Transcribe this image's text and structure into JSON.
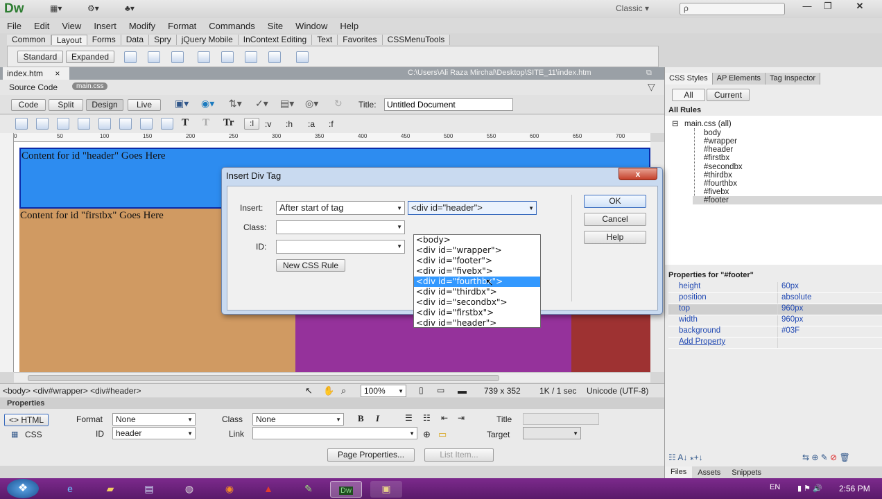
{
  "app": {
    "logo": "Dw",
    "workspace": "Classic ▾",
    "search_placeholder": "ρ"
  },
  "titlebar_icons": [
    "▦▾",
    "⚙▾",
    "♣▾"
  ],
  "menu": [
    "File",
    "Edit",
    "View",
    "Insert",
    "Modify",
    "Format",
    "Commands",
    "Site",
    "Window",
    "Help"
  ],
  "insert_tabs": [
    "Common",
    "Layout",
    "Forms",
    "Data",
    "Spry",
    "jQuery Mobile",
    "InContext Editing",
    "Text",
    "Favorites",
    "CSSMenuTools"
  ],
  "insert_bar": {
    "standard": "Standard",
    "expanded": "Expanded"
  },
  "document": {
    "tab": "index.htm",
    "tab_close": "×",
    "path": "C:\\Users\\Ali Raza Mirchal\\Desktop\\SITE_11\\index.htm",
    "source_code": "Source Code",
    "related_file": "main.css",
    "views": [
      "Code",
      "Split",
      "Design",
      "Live"
    ],
    "title_label": "Title:",
    "title_value": "Untitled Document"
  },
  "style_toolbar": [
    ":l",
    ":v",
    ":h",
    ":a",
    ":f"
  ],
  "ruler_ticks": [
    "0",
    "50",
    "100",
    "150",
    "200",
    "250",
    "300",
    "350",
    "400",
    "450",
    "500",
    "550",
    "600",
    "650",
    "700"
  ],
  "canvas": {
    "header_text": "Content for id \"header\" Goes Here",
    "firstbx_text": "Content for id \"firstbx\" Goes Here",
    "colors": {
      "header": "#2d8cf0",
      "firstbx": "#d09a62",
      "purple": "#95329b",
      "red": "#9e3232"
    }
  },
  "status": {
    "tag_path": "<body> <div#wrapper> <div#header>",
    "zoom": "100%",
    "dimensions": "739 x 352",
    "size": "1K / 1 sec",
    "encoding": "Unicode (UTF-8)"
  },
  "properties": {
    "title": "Properties",
    "html_label": "<> HTML",
    "css_label": "CSS",
    "format_label": "Format",
    "format_value": "None",
    "class_label": "Class",
    "class_value": "None",
    "id_label": "ID",
    "id_value": "header",
    "link_label": "Link",
    "title_label": "Title",
    "target_label": "Target",
    "page_properties": "Page Properties...",
    "list_item": "List Item..."
  },
  "right_panel": {
    "tabs": [
      "CSS Styles",
      "AP Elements",
      "Tag Inspector"
    ],
    "toggle": [
      "All",
      "Current"
    ],
    "all_rules": "All Rules",
    "tree_root": "main.css (all)",
    "rules": [
      "body",
      "#wrapper",
      "#header",
      "#firstbx",
      "#secondbx",
      "#thirdbx",
      "#fourthbx",
      "#fivebx",
      "#footer"
    ],
    "props_title": "Properties for \"#footer\"",
    "props": [
      {
        "name": "height",
        "value": "60px"
      },
      {
        "name": "position",
        "value": "absolute"
      },
      {
        "name": "top",
        "value": "960px"
      },
      {
        "name": "width",
        "value": "960px"
      },
      {
        "name": "background",
        "value": "#03F"
      }
    ],
    "add_property": "Add Property",
    "bottom_tabs": [
      "Files",
      "Assets",
      "Snippets"
    ]
  },
  "dialog": {
    "title": "Insert Div Tag",
    "close": "x",
    "insert_label": "Insert:",
    "insert_value": "After start of tag",
    "tag_value": "<div id=\"header\">",
    "class_label": "Class:",
    "id_label": "ID:",
    "new_css_rule": "New CSS Rule",
    "ok": "OK",
    "cancel": "Cancel",
    "help": "Help",
    "options": [
      "<body>",
      "<div id=\"wrapper\">",
      "<div id=\"footer\">",
      "<div id=\"fivebx\">",
      "<div id=\"fourthbx\">",
      "<div id=\"thirdbx\">",
      "<div id=\"secondbx\">",
      "<div id=\"firstbx\">",
      "<div id=\"header\">"
    ],
    "highlighted_index": 4
  },
  "taskbar": {
    "lang": "EN",
    "time": "2:56 PM"
  }
}
